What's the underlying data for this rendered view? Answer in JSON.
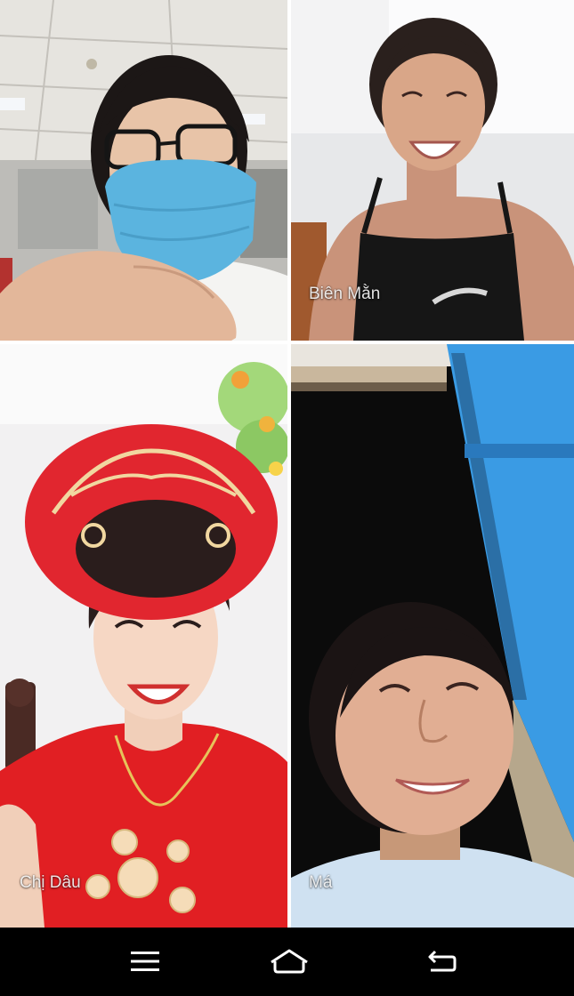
{
  "participants": [
    {
      "name": ""
    },
    {
      "name": "Biên Mằn"
    },
    {
      "name": "Chị Dâu"
    },
    {
      "name": "Má"
    }
  ],
  "navbar": {
    "menu_icon": "menu-icon",
    "home_icon": "home-icon",
    "back_icon": "back-icon"
  },
  "colors": {
    "background": "#000000",
    "divider": "#ffffff",
    "label": "#ffffff"
  }
}
